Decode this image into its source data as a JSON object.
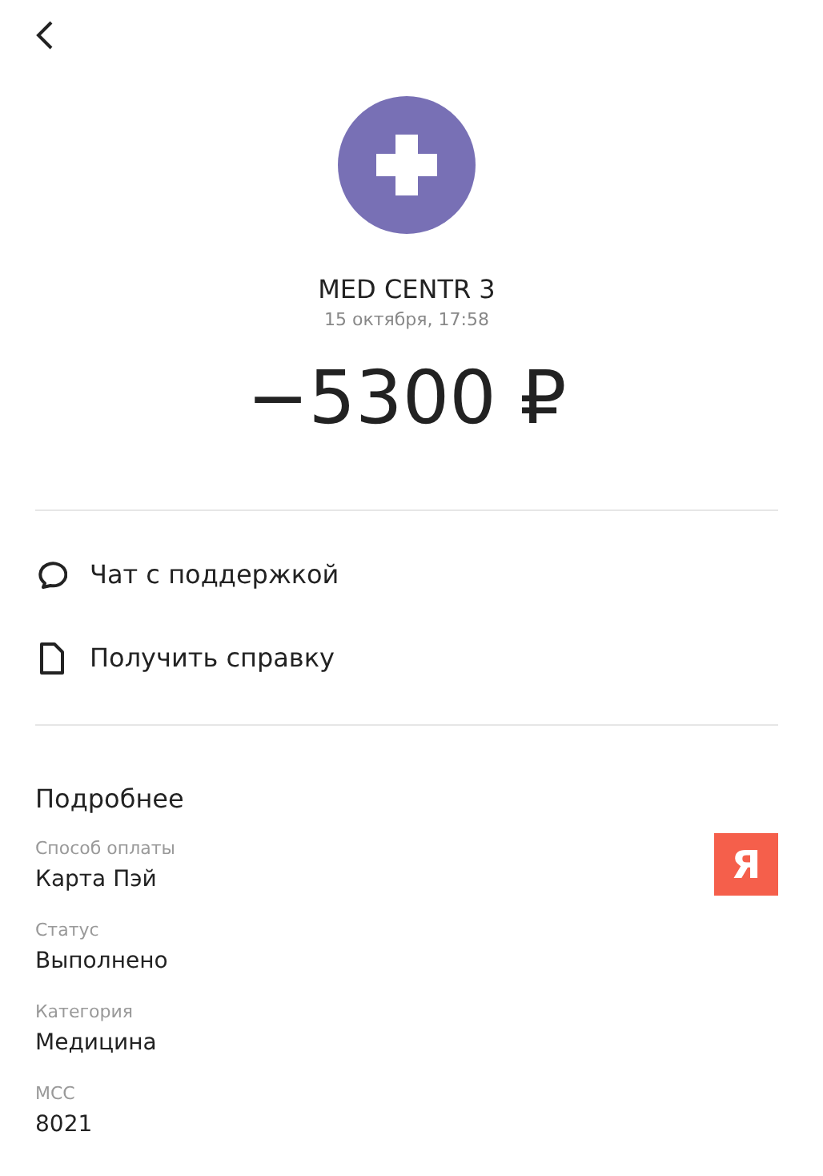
{
  "merchant": {
    "name": "MED CENTR 3",
    "datetime": "15 октября, 17:58",
    "amount": "−5300 ₽"
  },
  "actions": [
    {
      "kind": "chat",
      "label": "Чат с поддержкой"
    },
    {
      "kind": "document",
      "label": "Получить справку"
    }
  ],
  "details": {
    "title": "Подробнее",
    "fields": [
      {
        "label": "Способ оплаты",
        "value": "Карта Пэй",
        "badge": "Я"
      },
      {
        "label": "Статус",
        "value": "Выполнено"
      },
      {
        "label": "Категория",
        "value": "Медицина"
      },
      {
        "label": "MCC",
        "value": "8021"
      }
    ]
  }
}
